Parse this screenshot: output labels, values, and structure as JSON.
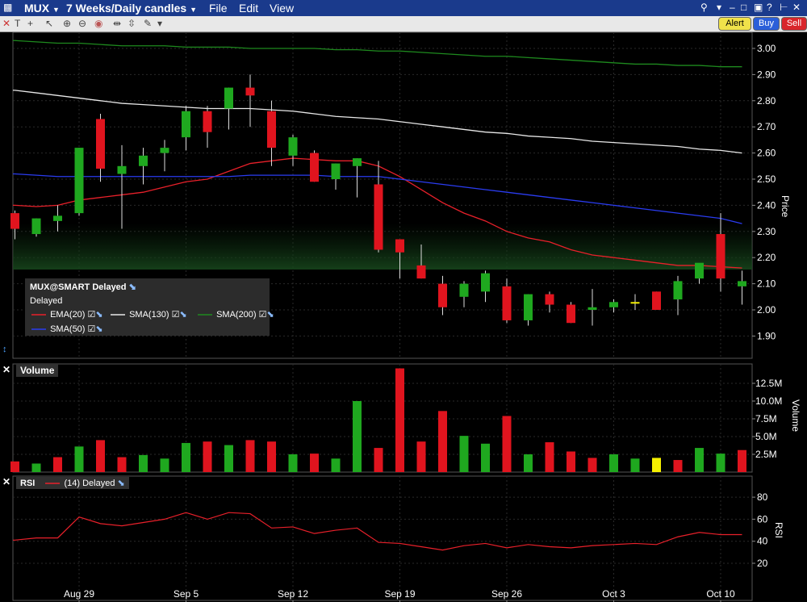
{
  "titlebar": {
    "symbol": "MUX",
    "interval": "7 Weeks/Daily candles",
    "menus": [
      "File",
      "Edit",
      "View"
    ],
    "buttons": {
      "alert": "Alert",
      "buy": "Buy",
      "sell": "Sell"
    }
  },
  "legend": {
    "title": "MUX@SMART Delayed",
    "status": "Delayed",
    "items": [
      {
        "label": "EMA(20)",
        "color": "#e8202a"
      },
      {
        "label": "SMA(130)",
        "color": "#e8e8e8"
      },
      {
        "label": "SMA(200)",
        "color": "#1e8a1e"
      },
      {
        "label": "SMA(50)",
        "color": "#2a3cf0"
      }
    ]
  },
  "volume_panel": {
    "label": "Volume",
    "axis_title": "Volume"
  },
  "rsi_panel": {
    "label": "RSI",
    "series_label": "(14) Delayed",
    "axis_title": "RSI"
  },
  "colors": {
    "up": "#1fa81f",
    "down": "#e0141e",
    "doji": "#f5f000",
    "background": "#000000",
    "titlebar": "#1a3a8c"
  },
  "chart_data": [
    {
      "type": "candlestick",
      "title": "MUX 7 Weeks/Daily candles",
      "ylabel": "Price",
      "ylim": [
        1.85,
        3.04
      ],
      "yticks": [
        "1.90",
        "2.00",
        "2.10",
        "2.20",
        "2.30",
        "2.40",
        "2.50",
        "2.60",
        "2.70",
        "2.80",
        "2.90",
        "3.00"
      ],
      "xticks": [
        "Aug 29",
        "Sep 5",
        "Sep 12",
        "Sep 19",
        "Sep 26",
        "Oct 3",
        "Oct 10"
      ],
      "xtick_index": [
        3,
        8,
        13,
        18,
        23,
        28,
        33
      ],
      "candles": [
        {
          "o": 2.37,
          "h": 2.38,
          "l": 2.27,
          "c": 2.31
        },
        {
          "o": 2.29,
          "h": 2.35,
          "l": 2.28,
          "c": 2.35
        },
        {
          "o": 2.34,
          "h": 2.4,
          "l": 2.3,
          "c": 2.36
        },
        {
          "o": 2.37,
          "h": 2.62,
          "l": 2.36,
          "c": 2.62
        },
        {
          "o": 2.73,
          "h": 2.75,
          "l": 2.49,
          "c": 2.54
        },
        {
          "o": 2.52,
          "h": 2.63,
          "l": 2.31,
          "c": 2.55
        },
        {
          "o": 2.55,
          "h": 2.62,
          "l": 2.48,
          "c": 2.59
        },
        {
          "o": 2.6,
          "h": 2.65,
          "l": 2.53,
          "c": 2.62
        },
        {
          "o": 2.66,
          "h": 2.78,
          "l": 2.61,
          "c": 2.76
        },
        {
          "o": 2.76,
          "h": 2.78,
          "l": 2.62,
          "c": 2.68
        },
        {
          "o": 2.77,
          "h": 2.85,
          "l": 2.69,
          "c": 2.85
        },
        {
          "o": 2.85,
          "h": 2.9,
          "l": 2.7,
          "c": 2.82
        },
        {
          "o": 2.76,
          "h": 2.8,
          "l": 2.55,
          "c": 2.62
        },
        {
          "o": 2.59,
          "h": 2.67,
          "l": 2.55,
          "c": 2.66
        },
        {
          "o": 2.6,
          "h": 2.61,
          "l": 2.49,
          "c": 2.49
        },
        {
          "o": 2.5,
          "h": 2.56,
          "l": 2.46,
          "c": 2.56
        },
        {
          "o": 2.55,
          "h": 2.58,
          "l": 2.43,
          "c": 2.58
        },
        {
          "o": 2.48,
          "h": 2.57,
          "l": 2.22,
          "c": 2.23
        },
        {
          "o": 2.27,
          "h": 2.27,
          "l": 2.12,
          "c": 2.22
        },
        {
          "o": 2.17,
          "h": 2.25,
          "l": 2.12,
          "c": 2.12
        },
        {
          "o": 2.1,
          "h": 2.13,
          "l": 1.98,
          "c": 2.01
        },
        {
          "o": 2.05,
          "h": 2.11,
          "l": 2.01,
          "c": 2.1
        },
        {
          "o": 2.07,
          "h": 2.15,
          "l": 2.03,
          "c": 2.14
        },
        {
          "o": 2.09,
          "h": 2.12,
          "l": 1.95,
          "c": 1.96
        },
        {
          "o": 1.96,
          "h": 2.06,
          "l": 1.94,
          "c": 2.06
        },
        {
          "o": 2.06,
          "h": 2.07,
          "l": 1.99,
          "c": 2.02
        },
        {
          "o": 2.02,
          "h": 2.03,
          "l": 1.95,
          "c": 1.95
        },
        {
          "o": 2.0,
          "h": 2.08,
          "l": 1.94,
          "c": 2.01
        },
        {
          "o": 2.01,
          "h": 2.04,
          "l": 1.99,
          "c": 2.03
        },
        {
          "o": 2.03,
          "h": 2.06,
          "l": 2.0,
          "c": 2.03
        },
        {
          "o": 2.07,
          "h": 2.07,
          "l": 2.0,
          "c": 2.0
        },
        {
          "o": 2.04,
          "h": 2.13,
          "l": 1.98,
          "c": 2.11
        },
        {
          "o": 2.12,
          "h": 2.14,
          "l": 2.1,
          "c": 2.18
        },
        {
          "o": 2.29,
          "h": 2.37,
          "l": 2.07,
          "c": 2.12
        },
        {
          "o": 2.09,
          "h": 2.15,
          "l": 2.02,
          "c": 2.11
        }
      ],
      "series": [
        {
          "name": "EMA(20)",
          "color": "#e8202a",
          "values": [
            2.4,
            2.395,
            2.4,
            2.42,
            2.43,
            2.44,
            2.45,
            2.47,
            2.49,
            2.5,
            2.53,
            2.56,
            2.57,
            2.58,
            2.575,
            2.57,
            2.57,
            2.55,
            2.51,
            2.46,
            2.41,
            2.37,
            2.34,
            2.3,
            2.275,
            2.26,
            2.23,
            2.21,
            2.2,
            2.19,
            2.18,
            2.17,
            2.17,
            2.165,
            2.16
          ]
        },
        {
          "name": "SMA(130)",
          "color": "#e8e8e8",
          "values": [
            2.84,
            2.83,
            2.82,
            2.81,
            2.8,
            2.79,
            2.785,
            2.78,
            2.775,
            2.77,
            2.77,
            2.77,
            2.765,
            2.76,
            2.75,
            2.74,
            2.735,
            2.73,
            2.72,
            2.71,
            2.7,
            2.69,
            2.68,
            2.675,
            2.665,
            2.66,
            2.655,
            2.645,
            2.64,
            2.635,
            2.63,
            2.625,
            2.615,
            2.61,
            2.6
          ]
        },
        {
          "name": "SMA(200)",
          "color": "#1e8a1e",
          "values": [
            3.03,
            3.025,
            3.02,
            3.02,
            3.015,
            3.01,
            3.01,
            3.01,
            3.005,
            3.005,
            3.005,
            3.0,
            3.0,
            3.0,
            3.0,
            2.995,
            2.995,
            2.99,
            2.99,
            2.985,
            2.98,
            2.975,
            2.97,
            2.97,
            2.965,
            2.96,
            2.955,
            2.95,
            2.945,
            2.94,
            2.94,
            2.935,
            2.935,
            2.93,
            2.93
          ]
        },
        {
          "name": "SMA(50)",
          "color": "#2a3cf0",
          "values": [
            2.52,
            2.515,
            2.51,
            2.51,
            2.51,
            2.51,
            2.51,
            2.51,
            2.51,
            2.51,
            2.51,
            2.515,
            2.515,
            2.515,
            2.515,
            2.51,
            2.51,
            2.51,
            2.5,
            2.49,
            2.48,
            2.47,
            2.46,
            2.45,
            2.44,
            2.43,
            2.42,
            2.41,
            2.4,
            2.39,
            2.38,
            2.37,
            2.36,
            2.35,
            2.33
          ]
        }
      ]
    },
    {
      "type": "bar",
      "title": "Volume",
      "ylabel": "Volume",
      "ylim": [
        0,
        14.5
      ],
      "yticks": [
        "2.5M",
        "5.0M",
        "7.5M",
        "10.0M",
        "12.5M"
      ],
      "unit": "M",
      "values": [
        1.5,
        1.2,
        2.1,
        3.6,
        4.5,
        2.1,
        2.4,
        1.9,
        4.1,
        4.3,
        3.8,
        4.5,
        4.3,
        2.5,
        2.6,
        1.9,
        10.0,
        3.4,
        14.6,
        4.3,
        8.6,
        5.1,
        4.0,
        7.9,
        2.5,
        4.2,
        2.9,
        2.0,
        2.5,
        1.9,
        2.0,
        1.7,
        3.4,
        2.6,
        3.1
      ],
      "colors": [
        "down",
        "up",
        "down",
        "up",
        "down",
        "down",
        "up",
        "up",
        "up",
        "down",
        "up",
        "down",
        "down",
        "up",
        "down",
        "up",
        "up",
        "down",
        "down",
        "down",
        "down",
        "up",
        "up",
        "down",
        "up",
        "down",
        "down",
        "down",
        "up",
        "up",
        "doji",
        "down",
        "up",
        "up",
        "down",
        "up"
      ]
    },
    {
      "type": "line",
      "title": "RSI",
      "series": [
        {
          "name": "(14) Delayed",
          "color": "#e8202a",
          "values": [
            41,
            43,
            43,
            62,
            56,
            54,
            57,
            60,
            66,
            60,
            66,
            65,
            52,
            53,
            47,
            50,
            52,
            39,
            38,
            35,
            32,
            36,
            38,
            34,
            37,
            35,
            34,
            36,
            37,
            38,
            37,
            44,
            48,
            46,
            46
          ]
        }
      ],
      "ylabel": "RSI",
      "ylim": [
        10,
        90
      ],
      "yticks": [
        "20",
        "40",
        "60",
        "80"
      ]
    }
  ]
}
